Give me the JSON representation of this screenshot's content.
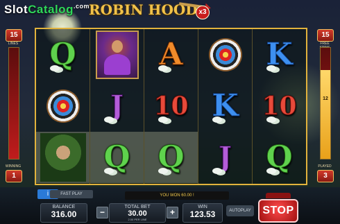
{
  "header": {
    "brand_slot": "Slot",
    "brand_catalog": "Catalog",
    "brand_com": ".com",
    "game_title": "ROBIN HOOD",
    "multiplier": "x3"
  },
  "left_panel": {
    "lines_value": "15",
    "lines_label": "LINES",
    "winning_label": "WINNING",
    "winning_value": "1"
  },
  "right_panel": {
    "free_spins_value": "15",
    "free_spins_label": "FREE SPINS",
    "meter_value": "12",
    "meter_max": 15,
    "played_label": "PLAYED",
    "played_value": "3"
  },
  "reels": [
    [
      {
        "symbol": "Q",
        "kind": "letter",
        "win": false
      },
      {
        "symbol": "target",
        "kind": "icon",
        "win": false
      },
      {
        "symbol": "archer",
        "kind": "icon",
        "win": true
      }
    ],
    [
      {
        "symbol": "maid",
        "kind": "icon",
        "win": false
      },
      {
        "symbol": "J",
        "kind": "letter",
        "win": false
      },
      {
        "symbol": "Q",
        "kind": "letter",
        "win": true
      }
    ],
    [
      {
        "symbol": "A",
        "kind": "letter",
        "win": false
      },
      {
        "symbol": "10",
        "kind": "letter",
        "win": false
      },
      {
        "symbol": "Q",
        "kind": "letter",
        "win": true
      }
    ],
    [
      {
        "symbol": "target",
        "kind": "icon",
        "win": false
      },
      {
        "symbol": "K",
        "kind": "letter",
        "win": false
      },
      {
        "symbol": "J",
        "kind": "letter",
        "win": false
      }
    ],
    [
      {
        "symbol": "K",
        "kind": "letter",
        "win": false
      },
      {
        "symbol": "10",
        "kind": "letter",
        "win": false
      },
      {
        "symbol": "Q",
        "kind": "letter",
        "win": false
      }
    ]
  ],
  "bottom": {
    "info_label": "i",
    "speed_label": "FAST PLAY",
    "win_message": "YOU WON 60.00 !",
    "balance_label": "BALANCE",
    "balance_value": "316.00",
    "total_bet_label": "TOTAL BET",
    "total_bet_value": "30.00",
    "per_line": "2.00 PER LINE",
    "win_label": "WIN",
    "win_value": "123.53",
    "autoplay_label": "AUTOPLAY",
    "stop_label": "STOP",
    "minus": "−",
    "plus": "+"
  },
  "colors": {
    "frame": "#e2b33c",
    "stop": "#d21b1b",
    "accent_green": "#2fd65a"
  }
}
